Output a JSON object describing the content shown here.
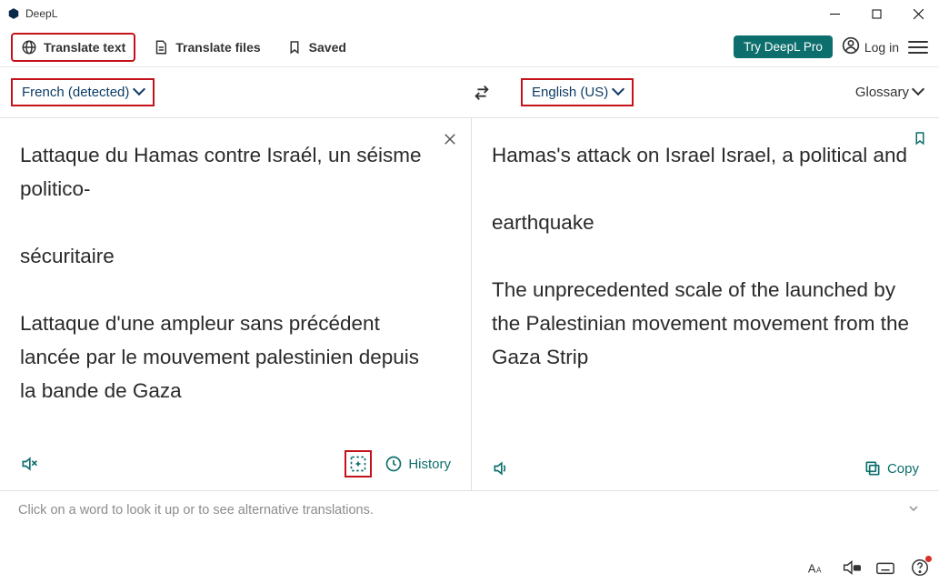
{
  "window": {
    "title": "DeepL"
  },
  "tabs": {
    "translate_text": "Translate text",
    "translate_files": "Translate files",
    "saved": "Saved"
  },
  "header": {
    "try_pro": "Try DeepL Pro",
    "login": "Log in"
  },
  "languages": {
    "source": "French (detected)",
    "target": "English (US)",
    "glossary": "Glossary"
  },
  "source_text": "Lattaque du Hamas contre Israél, un séisme politico-\n\nsécuritaire\n\nLattaque d'une ampleur sans précédent lancée par le mouvement palestinien depuis la bande de Gaza",
  "target_text": "Hamas's attack on Israel Israel, a political and\n\nearthquake\n\nThe unprecedented scale of the launched by the Palestinian movement movement from the Gaza Strip",
  "footer": {
    "history": "History",
    "copy": "Copy"
  },
  "hint": "Click on a word to look it up or to see alternative translations."
}
